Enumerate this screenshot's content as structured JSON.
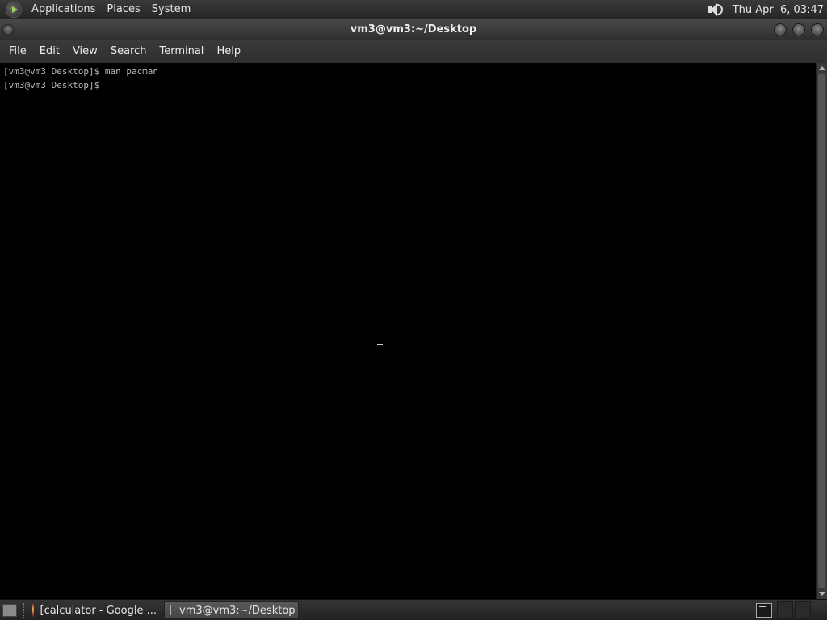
{
  "top_panel": {
    "menus": [
      "Applications",
      "Places",
      "System"
    ],
    "clock": "Thu Apr  6, 03:47",
    "icons": {
      "logo": "gnome-foot-icon",
      "volume": "speaker-icon"
    }
  },
  "window": {
    "title": "vm3@vm3:~/Desktop",
    "menus": [
      "File",
      "Edit",
      "View",
      "Search",
      "Terminal",
      "Help"
    ],
    "terminal": {
      "lines": [
        "[vm3@vm3 Desktop]$ man pacman",
        "[vm3@vm3 Desktop]$"
      ],
      "background": "#000000",
      "foreground": "#b9b9b9"
    }
  },
  "taskbar": {
    "tasks": [
      {
        "label": "[calculator - Google ...",
        "icon": "firefox-icon",
        "active": false
      },
      {
        "label": "vm3@vm3:~/Desktop",
        "icon": "terminal-icon",
        "active": true
      }
    ]
  }
}
